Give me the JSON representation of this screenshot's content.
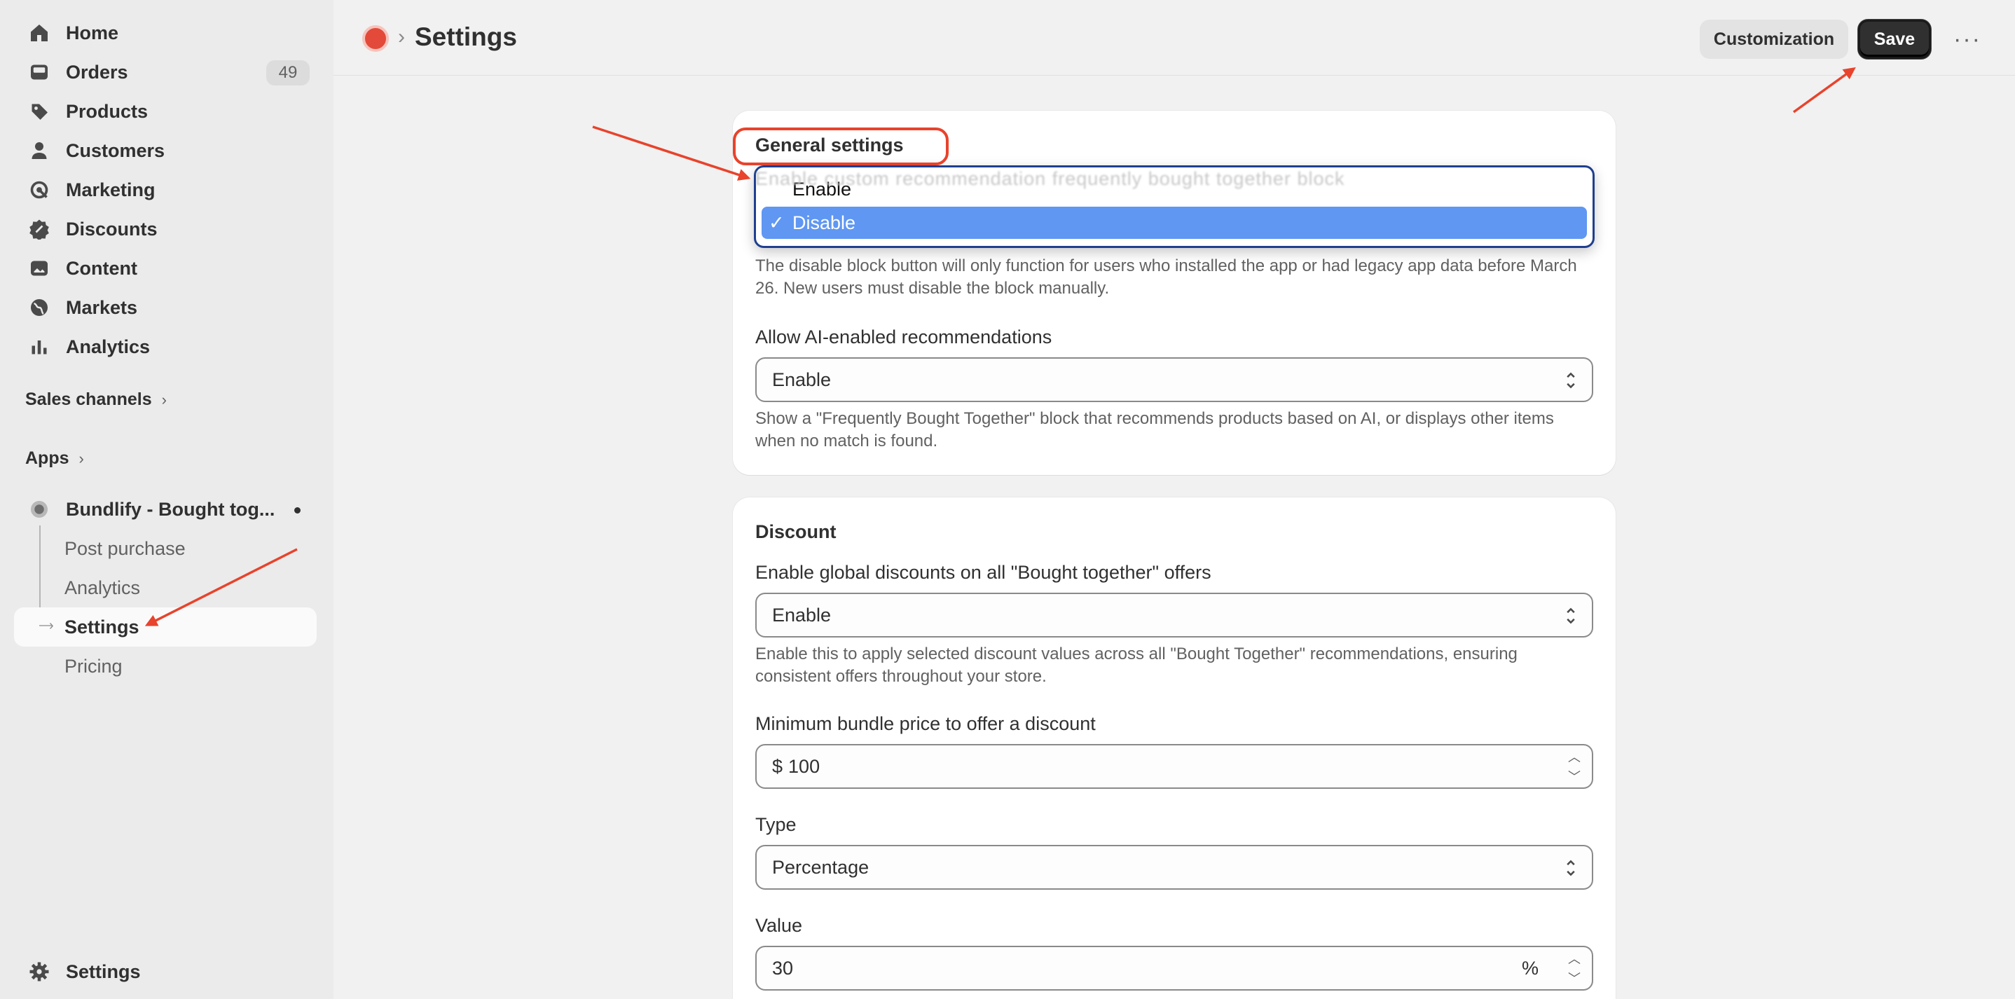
{
  "sidebar": {
    "nav": [
      {
        "label": "Home",
        "icon": "home-icon"
      },
      {
        "label": "Orders",
        "icon": "inbox-icon",
        "badge": "49"
      },
      {
        "label": "Products",
        "icon": "tag-icon"
      },
      {
        "label": "Customers",
        "icon": "person-icon"
      },
      {
        "label": "Marketing",
        "icon": "target-icon"
      },
      {
        "label": "Discounts",
        "icon": "discount-icon"
      },
      {
        "label": "Content",
        "icon": "image-icon"
      },
      {
        "label": "Markets",
        "icon": "globe-icon"
      },
      {
        "label": "Analytics",
        "icon": "bar-chart-icon"
      }
    ],
    "sales_channels": "Sales channels",
    "apps": "Apps",
    "app_name": "Bundlify - Bought tog...",
    "app_sub": [
      "Post purchase",
      "Analytics",
      "Settings",
      "Pricing"
    ],
    "bottom_settings": "Settings"
  },
  "header": {
    "title": "Settings",
    "customization_label": "Customization",
    "save_label": "Save",
    "more_label": "···"
  },
  "general": {
    "title": "General settings",
    "ghost_label": "Enable custom recommendation frequently bought together block",
    "dropdown_options": [
      "Enable",
      "Disable"
    ],
    "selected": "Disable",
    "check": "✓",
    "help1": "The disable block button will only function for users who installed the app or had legacy app data before March 26. New users must disable the block manually.",
    "ai_label": "Allow AI-enabled recommendations",
    "ai_value": "Enable",
    "ai_help": "Show a \"Frequently Bought Together\" block that recommends products based on AI, or displays other items when no match is found."
  },
  "discount": {
    "title": "Discount",
    "global_label": "Enable global discounts on all \"Bought together\" offers",
    "global_value": "Enable",
    "global_help": "Enable this to apply selected discount values across all \"Bought Together\" recommendations, ensuring consistent offers throughout your store.",
    "min_label": "Minimum bundle price to offer a discount",
    "min_prefix": "$",
    "min_value": "100",
    "type_label": "Type",
    "type_value": "Percentage",
    "value_label": "Value",
    "value_value": "30",
    "value_suffix": "%"
  },
  "colors": {
    "annotation": "#e8432c",
    "selection": "#5f97f2",
    "save_bg": "#303030"
  }
}
